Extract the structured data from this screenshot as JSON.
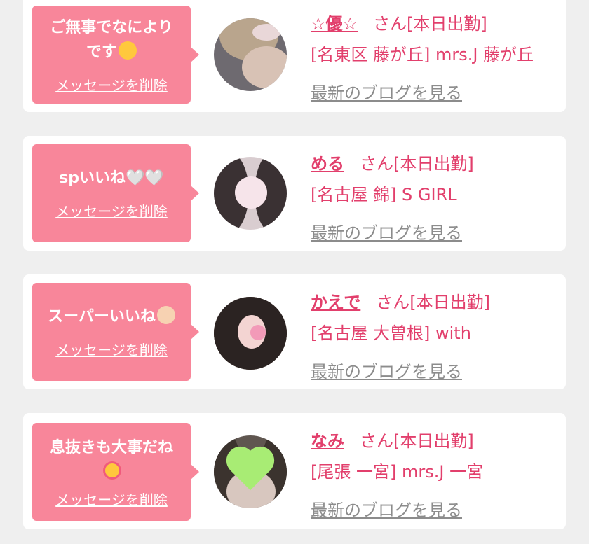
{
  "colors": {
    "background": "#efefef",
    "bubble": "#f8869a",
    "accent": "#e23f6c",
    "muted_link": "#8c8c8c"
  },
  "messages": [
    {
      "text": "ご無事でなにより",
      "text_line2": "です",
      "emoji": "smiling-face-emoji",
      "delete_label": "メッセージを削除",
      "name": "☆優☆",
      "suffix": "さん",
      "status": "[本日出勤]",
      "shop": "[名東区 藤が丘] mrs.J 藤が丘",
      "blog_label": "最新のブログを見る"
    },
    {
      "text": "spいいね🤍🤍",
      "emoji": "white-heart-emoji",
      "delete_label": "メッセージを削除",
      "name": "める",
      "suffix": "さん",
      "status": "[本日出勤]",
      "shop": "[名古屋 錦] S GIRL",
      "blog_label": "最新のブログを見る"
    },
    {
      "text": "スーパーいいね",
      "emoji": "baby-emoji",
      "delete_label": "メッセージを削除",
      "name": "かえで",
      "suffix": "さん",
      "status": "[本日出勤]",
      "shop": "[名古屋 大曽根] with",
      "blog_label": "最新のブログを見る"
    },
    {
      "text": "息抜きも大事だね",
      "emoji": "smiling-face-with-hearts-emoji",
      "delete_label": "メッセージを削除",
      "name": "なみ",
      "suffix": "さん",
      "status": "[本日出勤]",
      "shop": "[尾張 一宮] mrs.J 一宮",
      "blog_label": "最新のブログを見る"
    }
  ]
}
